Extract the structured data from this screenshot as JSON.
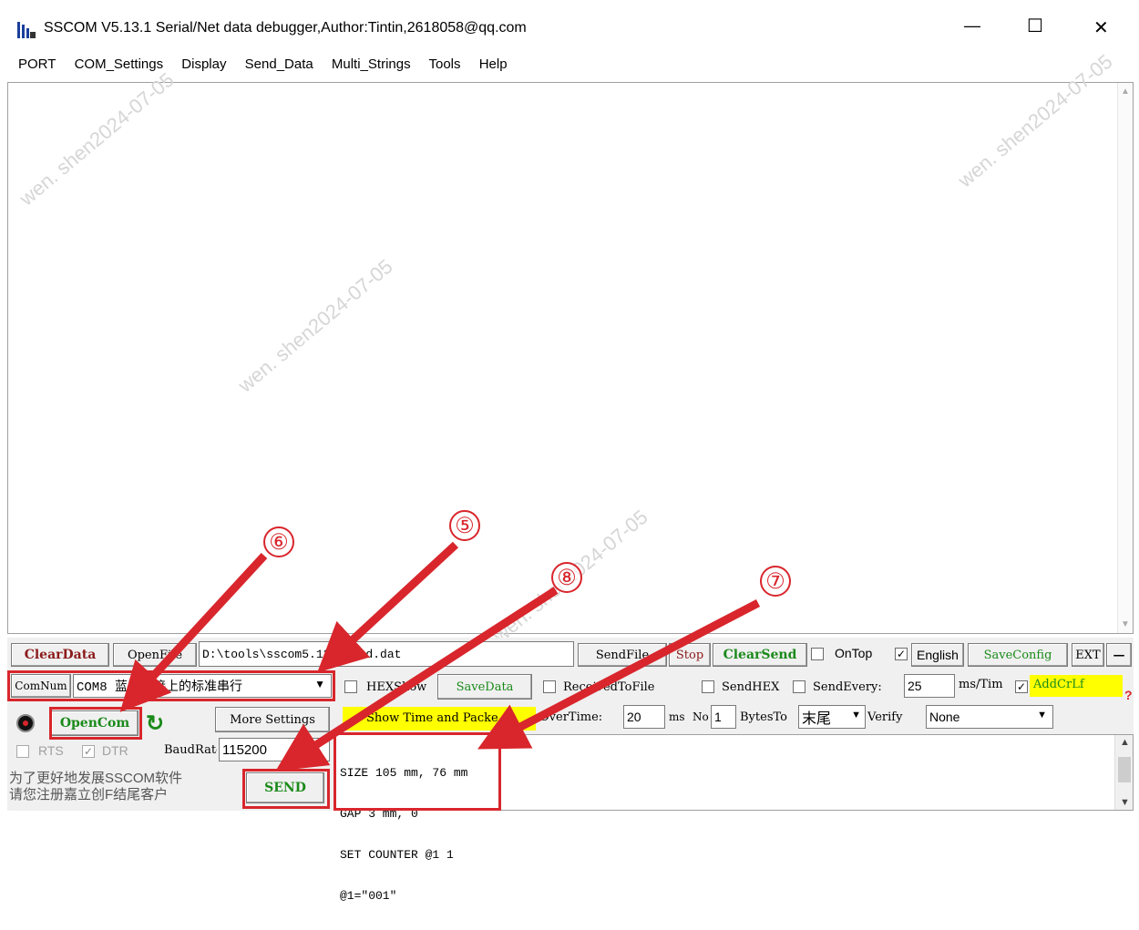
{
  "window": {
    "title": "SSCOM V5.13.1 Serial/Net data debugger,Author:Tintin,2618058@qq.com",
    "min_glyph": "—",
    "max_glyph": "☐",
    "close_glyph": "✕"
  },
  "menu": [
    "PORT",
    "COM_Settings",
    "Display",
    "Send_Data",
    "Multi_Strings",
    "Tools",
    "Help"
  ],
  "watermark": "wen. shen2024-07-05",
  "toolbar1": {
    "clear_data": "ClearData",
    "open_file": "OpenFile",
    "file_path": "D:\\tools\\sscom5.13.1\\cmd.dat",
    "send_file": "SendFile",
    "stop": "Stop",
    "clear_send": "ClearSend",
    "on_top": "OnTop",
    "english": "English",
    "save_config": "SaveConfig",
    "ext": "EXT",
    "minus": "—"
  },
  "row2": {
    "com_num_label": "ComNum",
    "com_value": "COM8 蓝牙链接上的标准串行",
    "hex_show": "HEXShow",
    "save_data": "SaveData",
    "received_to_file": "ReceivedToFile",
    "send_hex": "SendHEX",
    "send_every": "SendEvery:",
    "send_every_value": "25",
    "ms_tim": "ms/Tim",
    "add_crlf": "AddCrLf",
    "help_glyph": "?"
  },
  "row3": {
    "open_com": "OpenCom",
    "more_settings": "More Settings",
    "show_time": "Show Time and Packe",
    "overtime": "OverTime:",
    "overtime_value": "20",
    "ms": "ms",
    "no": "No",
    "no_value": "1",
    "bytes_to": "BytesTo",
    "bytes_to_value": "末尾",
    "verify": "Verify",
    "verify_value": "None"
  },
  "row4": {
    "rts": "RTS",
    "dtr": "DTR",
    "baud_label": "BaudRate",
    "baud_value": "115200"
  },
  "promo": [
    "为了更好地发展SSCOM软件",
    "请您注册嘉立创F结尾客户"
  ],
  "send_button": "SEND",
  "send_text": [
    "SIZE 105 mm, 76 mm",
    "GAP 3 mm, 0",
    "SET COUNTER @1 1",
    "@1=\"001\""
  ],
  "annotations": [
    "⑤",
    "⑥",
    "⑦",
    "⑧"
  ],
  "colors": {
    "accent_red": "#d8262c",
    "green_text": "#1a8a1a",
    "dark_red_text": "#8b1a1a",
    "yellow": "#ffff00"
  }
}
